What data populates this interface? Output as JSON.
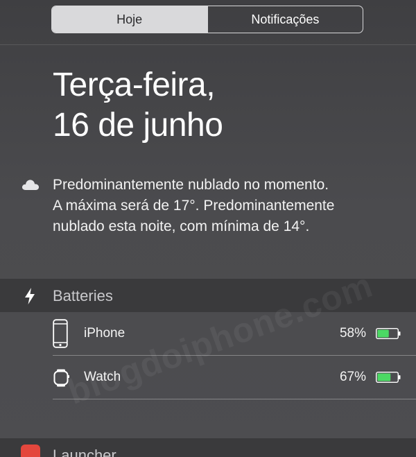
{
  "segmented": {
    "today_label": "Hoje",
    "notifications_label": "Notificações",
    "selected": "today"
  },
  "today": {
    "date_line1": "Terça-feira,",
    "date_line2": "16 de junho",
    "weather_icon": "cloud-icon",
    "weather_line1": "Predominantemente nublado no momento.",
    "weather_line2": "A máxima será de 17°. Predominantemente",
    "weather_line3": "nublado esta noite, com mínima de 14°."
  },
  "batteries_widget": {
    "icon": "lightning-bolt-icon",
    "title": "Batteries",
    "devices": [
      {
        "name": "iPhone",
        "icon": "iphone-icon",
        "percent_label": "58%",
        "level": 58
      },
      {
        "name": "Watch",
        "icon": "apple-watch-icon",
        "percent_label": "67%",
        "level": 67
      }
    ],
    "battery_fill_color": "#4cd964"
  },
  "launcher_widget": {
    "icon": "launcher-icon",
    "title": "Launcher",
    "icon_color": "#e4473d"
  },
  "watermark": "blogdoiphone.com"
}
